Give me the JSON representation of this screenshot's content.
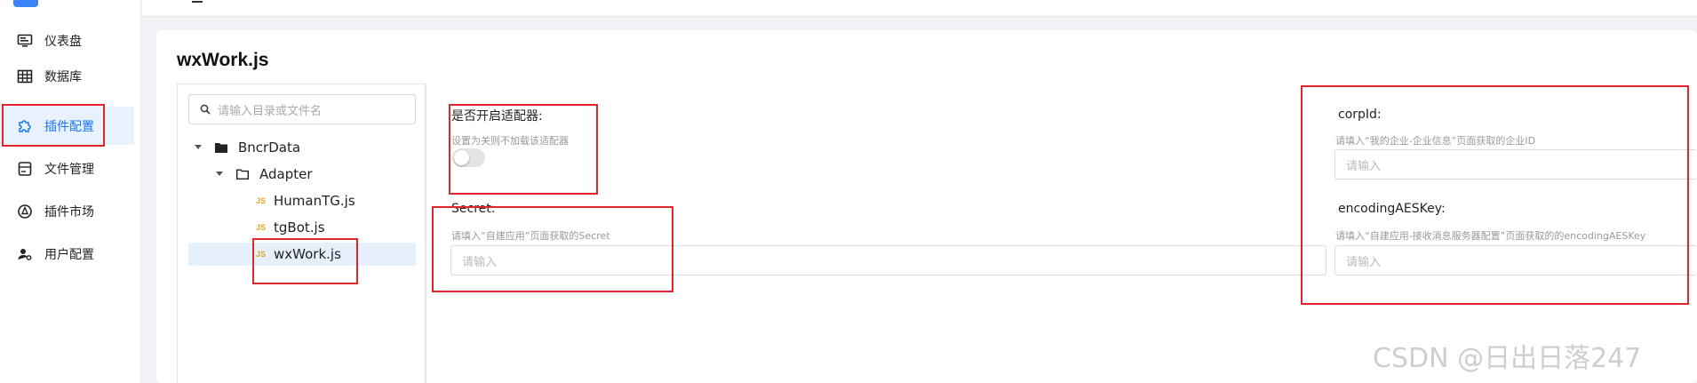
{
  "sidebar": {
    "items": [
      {
        "label": "仪表盘",
        "icon": "monitor-icon"
      },
      {
        "label": "数据库",
        "icon": "table-grid-icon"
      },
      {
        "label": "插件配置",
        "icon": "puzzle-icon"
      },
      {
        "label": "文件管理",
        "icon": "file-icon"
      },
      {
        "label": "插件市场",
        "icon": "compass-icon"
      },
      {
        "label": "用户配置",
        "icon": "user-gear-icon"
      }
    ],
    "active_index": 2
  },
  "page": {
    "title": "wxWork.js"
  },
  "tree": {
    "search_placeholder": "请输入目录或文件名",
    "root": "BncrData",
    "folder": "Adapter",
    "files": [
      "HumanTG.js",
      "tgBot.js",
      "wxWork.js"
    ],
    "file_badge": "JS",
    "selected_file": "wxWork.js"
  },
  "form": {
    "enable": {
      "label": "是否开启适配器:",
      "hint": "设置为关则不加载该适配器",
      "value": false
    },
    "secret": {
      "label": "Secret:",
      "hint": "请填入“自建应用”页面获取的Secret",
      "placeholder": "请输入"
    },
    "corpid": {
      "label": "corpId:",
      "hint": "请填入“我的企业-企业信息”页面获取的企业ID",
      "placeholder": "请输入"
    },
    "aeskey": {
      "label": "encodingAESKey:",
      "hint": "请填入“自建应用-接收消息服务器配置”页面获取的的encodingAESKey",
      "placeholder": "请输入"
    }
  },
  "watermark": "CSDN @日出日落247",
  "colors": {
    "accent": "#1677ff",
    "annotation": "#e0262b",
    "active_bg": "#e8f1fc"
  }
}
